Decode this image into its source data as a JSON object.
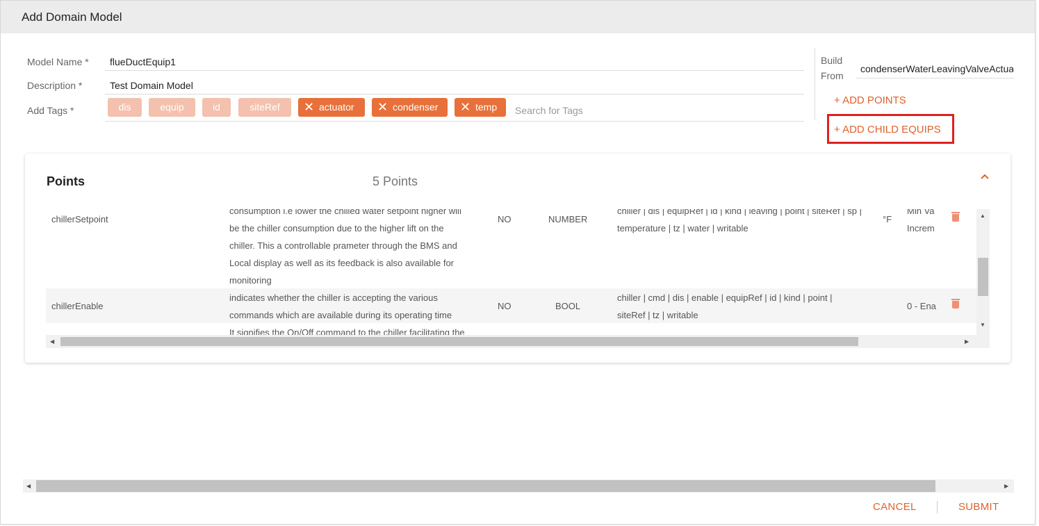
{
  "dialog": {
    "title": "Add Domain Model"
  },
  "form": {
    "model_name_label": "Model Name *",
    "model_name_value": "flueDuctEquip1",
    "description_label": "Description *",
    "description_value": "Test Domain Model",
    "tags_label": "Add Tags *",
    "fixed_tags": [
      "dis",
      "equip",
      "id",
      "siteRef"
    ],
    "removable_tags": [
      "actuator",
      "condenser",
      "temp"
    ],
    "tag_search_placeholder": "Search for Tags"
  },
  "side_panel": {
    "build_from_label_1": "Build",
    "build_from_label_2": "From",
    "build_from_value": "condenserWaterLeavingValveActuator",
    "add_points_label": "+ ADD POINTS",
    "add_child_equips_label": "+ ADD CHILD EQUIPS"
  },
  "points": {
    "title": "Points",
    "count": "5 Points",
    "rows": [
      {
        "name": "chillerSetpoint",
        "description": [
          "consumption i.e lower the chilled water setpoint higher will",
          "be the chiller consumption due to the higher lift on the",
          "chiller. This a controllable prameter through the BMS and",
          "Local display as well as its feedback is also available for",
          "monitoring"
        ],
        "flag": "NO",
        "kind": "NUMBER",
        "tags": [
          "chiller | dis | equipRef | id | kind | leaving | point | siteRef | sp |",
          "temperature | tz | water | writable"
        ],
        "unit": "°F",
        "extra": [
          "Min Va",
          "Increm"
        ]
      },
      {
        "name": "chillerEnable",
        "description": [
          "indicates whether the chiller is accepting the various",
          "commands which are available during its operating time"
        ],
        "flag": "NO",
        "kind": "BOOL",
        "tags": [
          "chiller | cmd | dis | enable | equipRef | id | kind | point |",
          "siteRef | tz | writable"
        ],
        "unit": "",
        "extra": [
          "0 - Ena"
        ]
      },
      {
        "name": "",
        "description": [
          "It signifies the On/Off command to the chiller facilitating the"
        ],
        "flag": "",
        "kind": "",
        "tags": [],
        "unit": "",
        "extra": []
      }
    ]
  },
  "footer": {
    "cancel_label": "CANCEL",
    "submit_label": "SUBMIT"
  },
  "colors": {
    "accent": "#e0622b",
    "tag_dark": "#e8703a",
    "tag_light": "#f3c1ad",
    "highlight": "#e02020"
  },
  "icons": {
    "remove_tag": "close-icon",
    "delete_row": "trash-icon",
    "collapse": "chevron-up-icon"
  }
}
